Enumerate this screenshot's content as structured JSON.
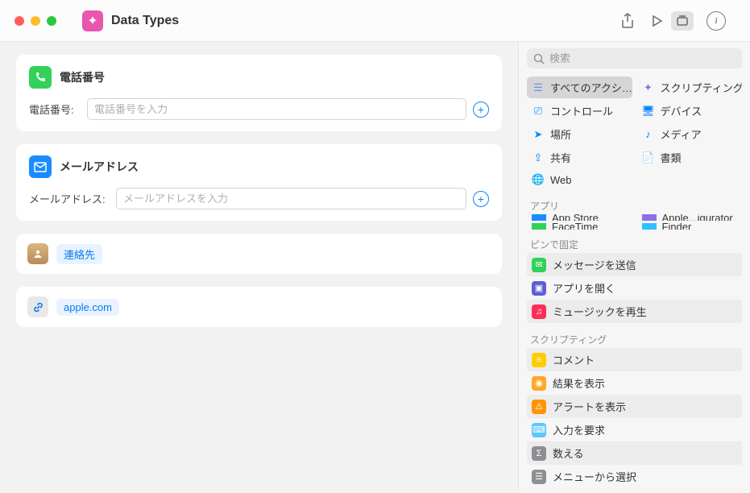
{
  "window": {
    "title": "Data Types"
  },
  "search": {
    "placeholder": "検索"
  },
  "actions": {
    "phone": {
      "title": "電話番号",
      "field_label": "電話番号:",
      "placeholder": "電話番号を入力"
    },
    "mail": {
      "title": "メールアドレス",
      "field_label": "メールアドレス:",
      "placeholder": "メールアドレスを入力"
    },
    "contact": {
      "chip": "連絡先"
    },
    "url": {
      "chip": "apple.com"
    }
  },
  "categories": [
    {
      "label": "すべてのアクシ…",
      "color": "#6b8eff",
      "selected": true
    },
    {
      "label": "スクリプティング",
      "color": "#8a6fe8"
    },
    {
      "label": "コントロール",
      "color": "#0a84ff"
    },
    {
      "label": "デバイス",
      "color": "#0a84ff"
    },
    {
      "label": "場所",
      "color": "#0a84ff"
    },
    {
      "label": "メディア",
      "color": "#0a84ff"
    },
    {
      "label": "共有",
      "color": "#0a84ff"
    },
    {
      "label": "書類",
      "color": "#0a84ff"
    },
    {
      "label": "Web",
      "color": "#0a84ff"
    }
  ],
  "sections": {
    "apps_label": "アプリ",
    "pinned_label": "ピンで固定",
    "scripting_label": "スクリプティング"
  },
  "apps": [
    {
      "label": "App Store",
      "color": "#1a8cff"
    },
    {
      "label": "Apple...igurator",
      "color": "#8a6fe8"
    },
    {
      "label": "FaceTime",
      "color": "#32d158"
    },
    {
      "label": "Finder",
      "color": "#2fc0ff"
    }
  ],
  "pinned": [
    {
      "label": "メッセージを送信",
      "color": "#32d158"
    },
    {
      "label": "アプリを開く",
      "color": "#5b5fd6"
    },
    {
      "label": "ミュージックを再生",
      "color": "#ff2d55"
    }
  ],
  "scripting": [
    {
      "label": "コメント",
      "color": "#ffcc00"
    },
    {
      "label": "結果を表示",
      "color": "#ffa726"
    },
    {
      "label": "アラートを表示",
      "color": "#ff9500"
    },
    {
      "label": "入力を要求",
      "color": "#5ac8fa"
    },
    {
      "label": "数える",
      "color": "#8e8e93"
    },
    {
      "label": "メニューから選択",
      "color": "#8e8e93"
    }
  ]
}
